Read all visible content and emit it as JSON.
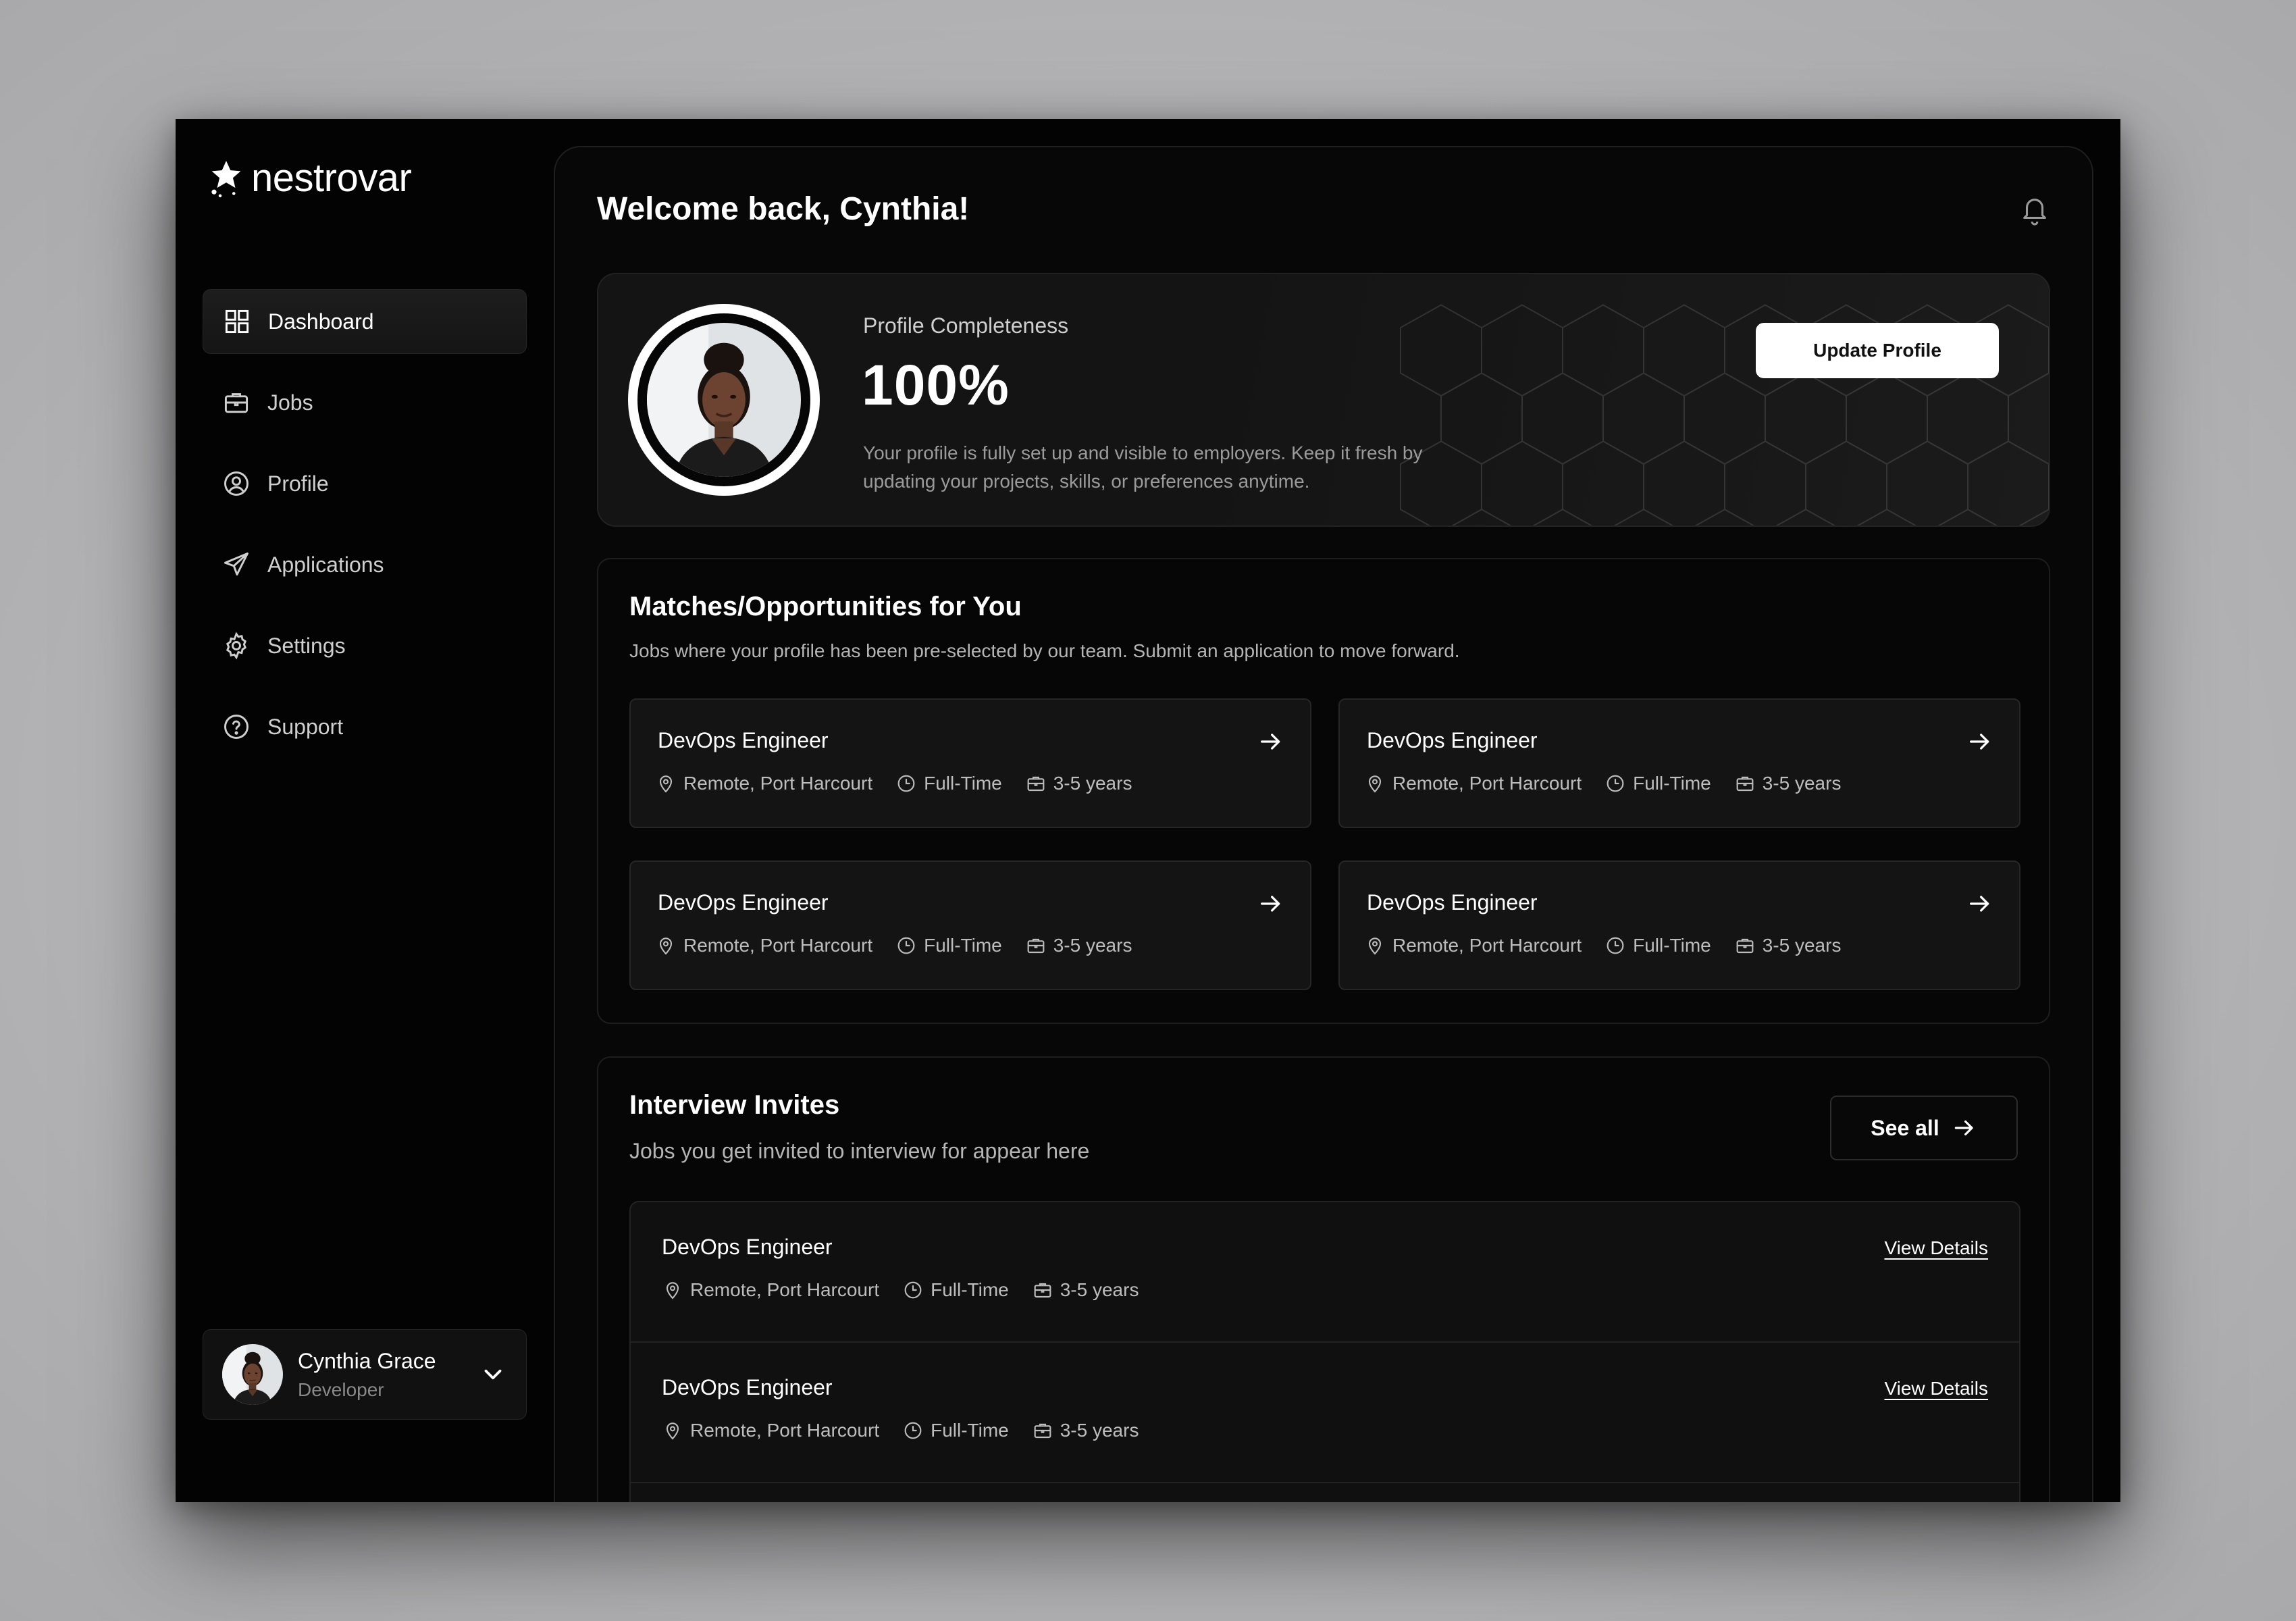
{
  "brand": {
    "name": "nestrovar"
  },
  "sidebar": {
    "items": [
      {
        "label": "Dashboard",
        "icon": "grid-icon",
        "active": true
      },
      {
        "label": "Jobs",
        "icon": "briefcase-icon"
      },
      {
        "label": "Profile",
        "icon": "user-circle-icon"
      },
      {
        "label": "Applications",
        "icon": "send-icon"
      },
      {
        "label": "Settings",
        "icon": "gear-icon"
      },
      {
        "label": "Support",
        "icon": "help-circle-icon"
      }
    ],
    "user": {
      "name": "Cynthia Grace",
      "role": "Developer"
    }
  },
  "header": {
    "welcome": "Welcome back, Cynthia!"
  },
  "profile": {
    "label": "Profile Completeness",
    "value": "100%",
    "completeness": 1.0,
    "description": "Your profile is fully set up and visible to employers. Keep it fresh by updating your projects, skills, or preferences anytime.",
    "button": "Update Profile"
  },
  "matches": {
    "title": "Matches/Opportunities for You",
    "subtitle": "Jobs where your profile has been pre-selected by our team. Submit an application to move forward.",
    "jobs": [
      {
        "title": "DevOps Engineer",
        "location": "Remote, Port Harcourt",
        "type": "Full-Time",
        "experience": "3-5 years"
      },
      {
        "title": "DevOps Engineer",
        "location": "Remote, Port Harcourt",
        "type": "Full-Time",
        "experience": "3-5 years"
      },
      {
        "title": "DevOps Engineer",
        "location": "Remote, Port Harcourt",
        "type": "Full-Time",
        "experience": "3-5 years"
      },
      {
        "title": "DevOps Engineer",
        "location": "Remote, Port Harcourt",
        "type": "Full-Time",
        "experience": "3-5 years"
      }
    ]
  },
  "invites": {
    "title": "Interview Invites",
    "subtitle": "Jobs you get invited to interview for appear here",
    "see_all": "See all",
    "items": [
      {
        "title": "DevOps Engineer",
        "location": "Remote, Port Harcourt",
        "type": "Full-Time",
        "experience": "3-5 years",
        "action": "View Details"
      },
      {
        "title": "DevOps Engineer",
        "location": "Remote, Port Harcourt",
        "type": "Full-Time",
        "experience": "3-5 years",
        "action": "View Details"
      }
    ]
  },
  "colors": {
    "background": "#030303",
    "card": "#141414",
    "accent": "#ffffff",
    "muted": "#9b9b9b"
  }
}
